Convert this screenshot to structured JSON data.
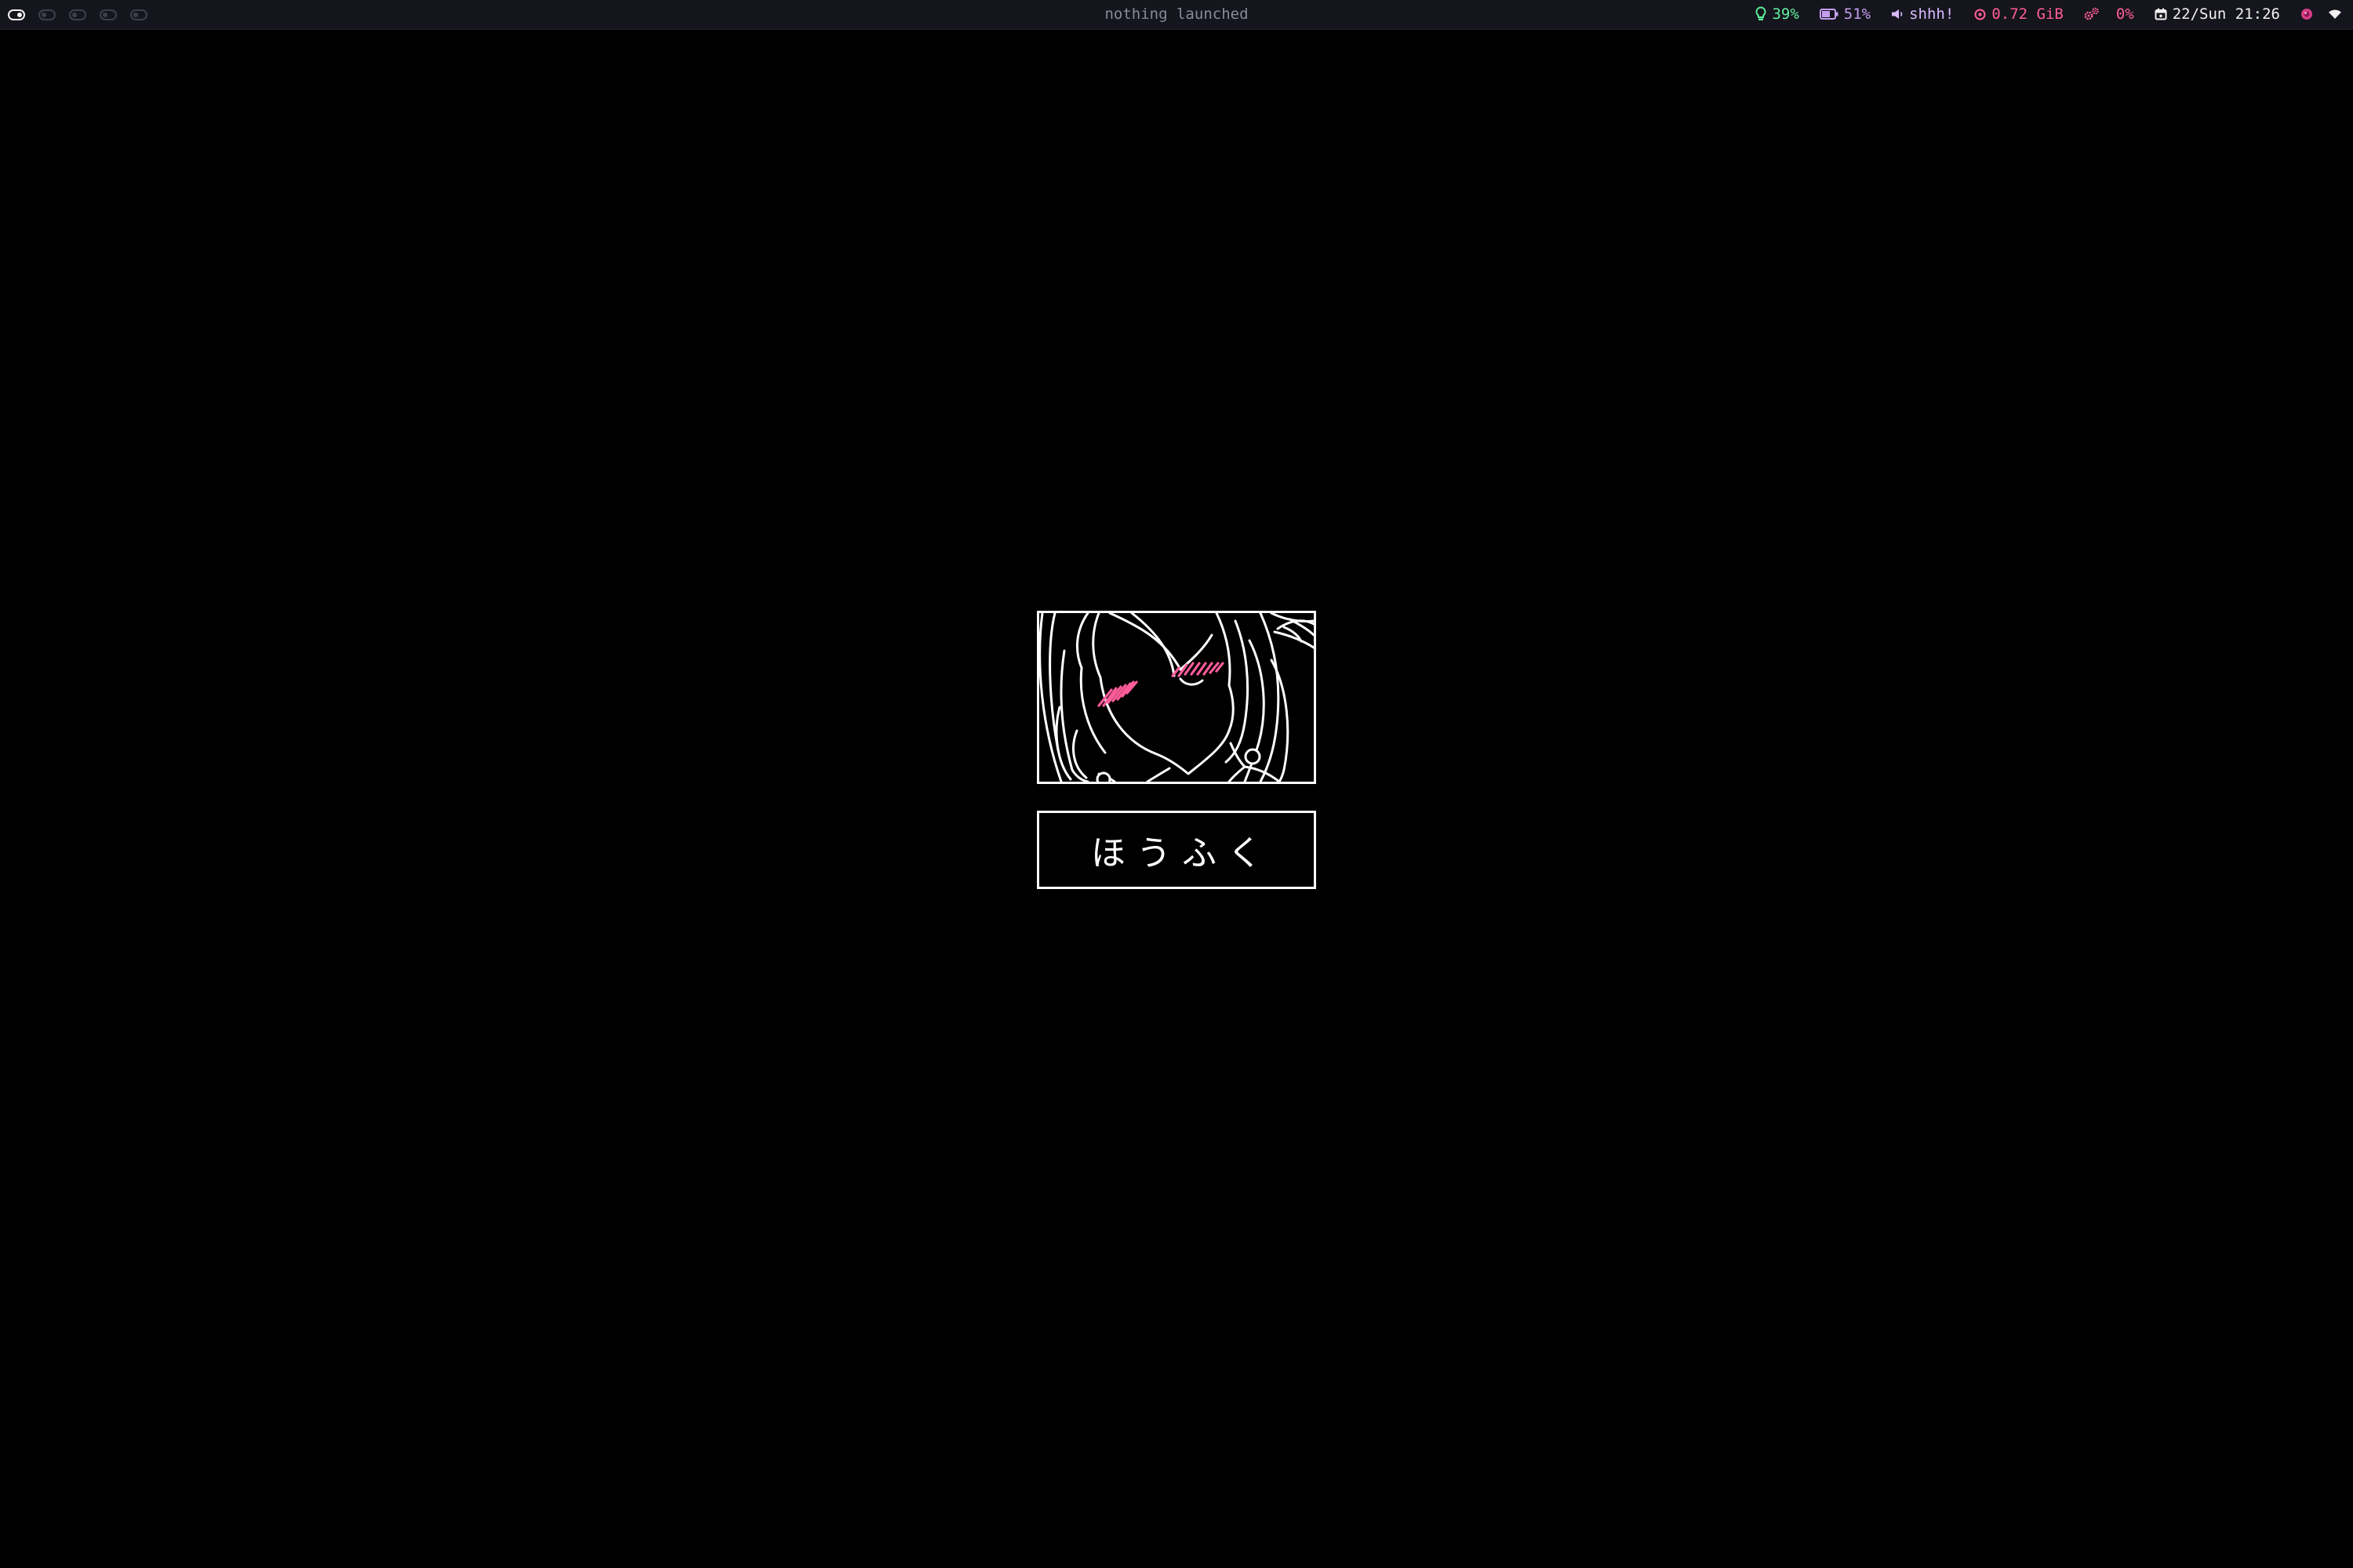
{
  "colors": {
    "bar_bg": "#15151d",
    "background": "#000000",
    "green": "#5ef09c",
    "purple": "#c59ef0",
    "pink": "#ff5c9a",
    "white": "#f2f2f2"
  },
  "topbar": {
    "workspaces": [
      {
        "active": true
      },
      {
        "active": false
      },
      {
        "active": false
      },
      {
        "active": false
      },
      {
        "active": false
      }
    ],
    "window_title": "nothing launched",
    "modules": {
      "brightness": {
        "icon": "lightbulb-icon",
        "value": "39%"
      },
      "battery": {
        "icon": "battery-icon",
        "value": "51%"
      },
      "volume": {
        "icon": "speaker-icon",
        "value": "shhh!"
      },
      "memory": {
        "icon": "memory-icon",
        "value": "0.72 GiB"
      },
      "cpu": {
        "icon": "gears-icon",
        "value": "0%"
      },
      "clock": {
        "icon": "calendar-icon",
        "value": "22/Sun 21:26"
      },
      "tray": [
        {
          "icon": "pink-circle-app-icon"
        },
        {
          "icon": "wifi-icon"
        }
      ]
    }
  },
  "center": {
    "emblem": {
      "icon": "anime-girl-lineart-icon",
      "blush_color": "#ff5c9a"
    },
    "name_label": "ほうふく"
  }
}
